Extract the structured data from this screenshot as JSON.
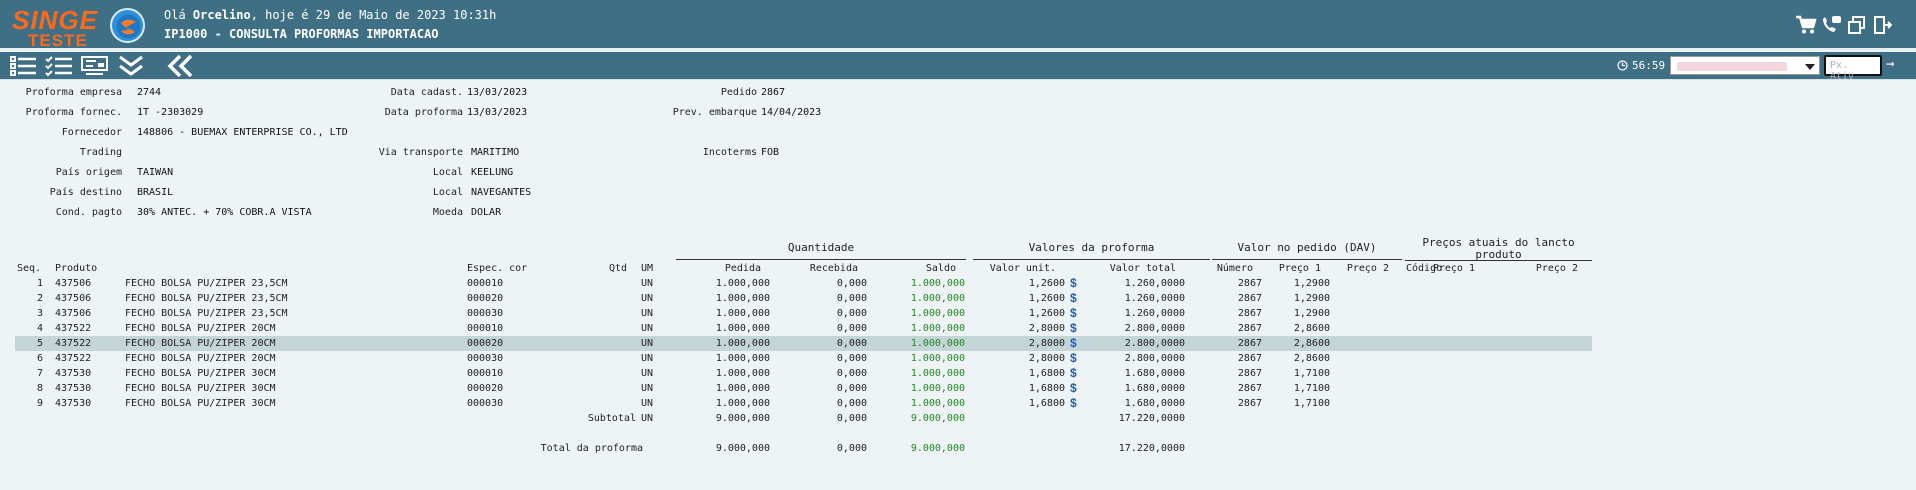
{
  "header": {
    "logo_top": "SINGE",
    "logo_bottom": "TESTE",
    "greeting_prefix": "Olá ",
    "user": "Orcelino",
    "greeting_suffix": ", hoje é 29 de Maio de 2023 10:31h",
    "screen_title": "IP1000 - CONSULTA PROFORMAS IMPORTACAO",
    "icons": [
      "cart-icon",
      "support-chat-icon",
      "windows-icon",
      "logout-icon"
    ]
  },
  "toolbar": {
    "icons": [
      "list-icon",
      "checklist-icon",
      "form-view-icon",
      "expand-down-icon",
      "back-icon"
    ],
    "timer": "56:59",
    "px_placeholder": "Px. Ativ",
    "go_symbol": "→"
  },
  "form": {
    "proforma_empresa": {
      "label": "Proforma empresa",
      "value": "2744"
    },
    "proforma_fornec": {
      "label": "Proforma fornec.",
      "value": "1T -2303029"
    },
    "fornecedor": {
      "label": "Fornecedor",
      "value": "148806 - BUEMAX ENTERPRISE CO., LTD"
    },
    "trading": {
      "label": "Trading",
      "value": ""
    },
    "pais_origem": {
      "label": "País origem",
      "value": "TAIWAN"
    },
    "pais_destino": {
      "label": "País destino",
      "value": "BRASIL"
    },
    "cond_pagto": {
      "label": "Cond. pagto",
      "value": "30% ANTEC. + 70% COBR.A VISTA"
    },
    "data_cadast": {
      "label": "Data cadast.",
      "value": "13/03/2023"
    },
    "data_proforma": {
      "label": "Data proforma",
      "value": "13/03/2023"
    },
    "via_transporte": {
      "label": "Via transporte",
      "value": "MARITIMO"
    },
    "local1": {
      "label": "Local",
      "value": "KEELUNG"
    },
    "local2": {
      "label": "Local",
      "value": "NAVEGANTES"
    },
    "moeda": {
      "label": "Moeda",
      "value": "DOLAR"
    },
    "pedido": {
      "label": "Pedido",
      "value": "2867"
    },
    "prev_embarque": {
      "label": "Prev. embarque",
      "value": "14/04/2023"
    },
    "incoterms": {
      "label": "Incoterms",
      "value": "FOB"
    }
  },
  "table": {
    "groups": {
      "quantidade": "Quantidade",
      "valores": "Valores da proforma",
      "valor_pedido": "Valor no pedido (DAV)",
      "precos_l1": "Preços atuais do lancto",
      "precos_l2": "produto"
    },
    "columns": {
      "seq": "Seq.",
      "produto": "Produto",
      "espec": "Espec. cor",
      "qtd": "Qtd",
      "um": "UM",
      "pedida": "Pedida",
      "recebida": "Recebida",
      "saldo": "Saldo",
      "valor_unit": "Valor unit.",
      "valor_total": "Valor total",
      "numero": "Número",
      "preco1": "Preço 1",
      "preco2": "Preço 2",
      "codigo": "Código",
      "preco1b": "Preço 1",
      "preco2b": "Preço 2"
    },
    "rows": [
      {
        "seq": "1",
        "produto": "437506",
        "desc": "FECHO BOLSA PU/ZIPER 23,5CM",
        "espec": "000010",
        "um": "UN",
        "pedida": "1.000,000",
        "recebida": "0,000",
        "saldo": "1.000,000",
        "unit": "1,2600",
        "cur": "$",
        "total": "1.260,0000",
        "numero": "2867",
        "preco1": "1,2900",
        "highlight": false
      },
      {
        "seq": "2",
        "produto": "437506",
        "desc": "FECHO BOLSA PU/ZIPER 23,5CM",
        "espec": "000020",
        "um": "UN",
        "pedida": "1.000,000",
        "recebida": "0,000",
        "saldo": "1.000,000",
        "unit": "1,2600",
        "cur": "$",
        "total": "1.260,0000",
        "numero": "2867",
        "preco1": "1,2900",
        "highlight": false
      },
      {
        "seq": "3",
        "produto": "437506",
        "desc": "FECHO BOLSA PU/ZIPER 23,5CM",
        "espec": "000030",
        "um": "UN",
        "pedida": "1.000,000",
        "recebida": "0,000",
        "saldo": "1.000,000",
        "unit": "1,2600",
        "cur": "$",
        "total": "1.260,0000",
        "numero": "2867",
        "preco1": "1,2900",
        "highlight": false
      },
      {
        "seq": "4",
        "produto": "437522",
        "desc": "FECHO BOLSA PU/ZIPER 20CM",
        "espec": "000010",
        "um": "UN",
        "pedida": "1.000,000",
        "recebida": "0,000",
        "saldo": "1.000,000",
        "unit": "2,8000",
        "cur": "$",
        "total": "2.800,0000",
        "numero": "2867",
        "preco1": "2,8600",
        "highlight": false
      },
      {
        "seq": "5",
        "produto": "437522",
        "desc": "FECHO BOLSA PU/ZIPER 20CM",
        "espec": "000020",
        "um": "UN",
        "pedida": "1.000,000",
        "recebida": "0,000",
        "saldo": "1.000,000",
        "unit": "2,8000",
        "cur": "$",
        "total": "2.800,0000",
        "numero": "2867",
        "preco1": "2,8600",
        "highlight": true
      },
      {
        "seq": "6",
        "produto": "437522",
        "desc": "FECHO BOLSA PU/ZIPER 20CM",
        "espec": "000030",
        "um": "UN",
        "pedida": "1.000,000",
        "recebida": "0,000",
        "saldo": "1.000,000",
        "unit": "2,8000",
        "cur": "$",
        "total": "2.800,0000",
        "numero": "2867",
        "preco1": "2,8600",
        "highlight": false
      },
      {
        "seq": "7",
        "produto": "437530",
        "desc": "FECHO BOLSA PU/ZIPER 30CM",
        "espec": "000010",
        "um": "UN",
        "pedida": "1.000,000",
        "recebida": "0,000",
        "saldo": "1.000,000",
        "unit": "1,6800",
        "cur": "$",
        "total": "1.680,0000",
        "numero": "2867",
        "preco1": "1,7100",
        "highlight": false
      },
      {
        "seq": "8",
        "produto": "437530",
        "desc": "FECHO BOLSA PU/ZIPER 30CM",
        "espec": "000020",
        "um": "UN",
        "pedida": "1.000,000",
        "recebida": "0,000",
        "saldo": "1.000,000",
        "unit": "1,6800",
        "cur": "$",
        "total": "1.680,0000",
        "numero": "2867",
        "preco1": "1,7100",
        "highlight": false
      },
      {
        "seq": "9",
        "produto": "437530",
        "desc": "FECHO BOLSA PU/ZIPER 30CM",
        "espec": "000030",
        "um": "UN",
        "pedida": "1.000,000",
        "recebida": "0,000",
        "saldo": "1.000,000",
        "unit": "1,6800",
        "cur": "$",
        "total": "1.680,0000",
        "numero": "2867",
        "preco1": "1,7100",
        "highlight": false
      }
    ],
    "subtotal": {
      "label": "Subtotal",
      "um": "UN",
      "pedida": "9.000,000",
      "recebida": "0,000",
      "saldo": "9.000,000",
      "total": "17.220,0000"
    },
    "total": {
      "label": "Total da proforma",
      "pedida": "9.000,000",
      "recebida": "0,000",
      "saldo": "9.000,000",
      "total": "17.220,0000"
    }
  },
  "colors": {
    "header_bg": "#3f6f84",
    "page_bg": "#eef4f6",
    "saldo": "#1e8a1e",
    "currency": "#1a62c7",
    "highlight_row": "#c3d5d7",
    "logo": "#ff6a1a"
  }
}
